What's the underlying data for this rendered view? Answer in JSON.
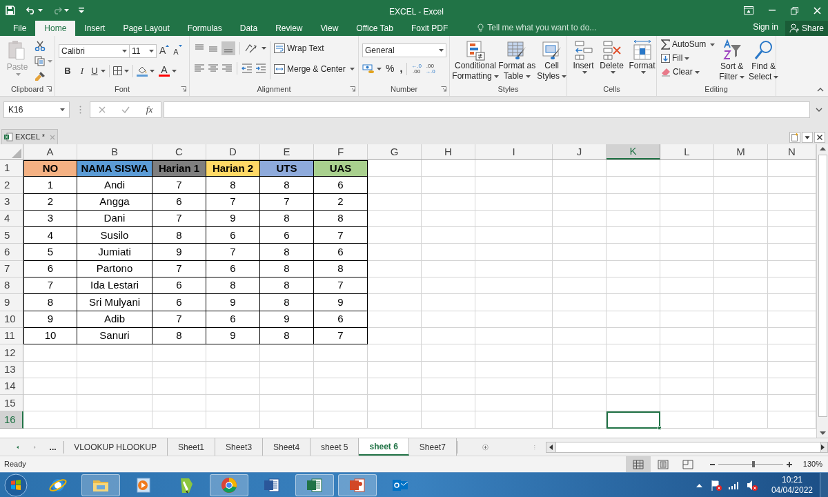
{
  "title_bar": {
    "title": "EXCEL - Excel"
  },
  "menu_tabs": [
    {
      "label": "File",
      "selected": false
    },
    {
      "label": "Home",
      "selected": true
    },
    {
      "label": "Insert",
      "selected": false
    },
    {
      "label": "Page Layout",
      "selected": false
    },
    {
      "label": "Formulas",
      "selected": false
    },
    {
      "label": "Data",
      "selected": false
    },
    {
      "label": "Review",
      "selected": false
    },
    {
      "label": "View",
      "selected": false
    },
    {
      "label": "Office Tab",
      "selected": false
    },
    {
      "label": "Foxit PDF",
      "selected": false
    }
  ],
  "tell_me": {
    "placeholder": "Tell me what you want to do..."
  },
  "sign_in": "Sign in",
  "share": "Share",
  "ribbon": {
    "clipboard": {
      "label": "Clipboard",
      "paste": "Paste"
    },
    "font": {
      "label": "Font",
      "font_name": "Calibri",
      "font_size": "11",
      "grow": "A",
      "shrink": "A",
      "bold": "B",
      "italic": "I",
      "underline": "U",
      "font_color": "A"
    },
    "alignment": {
      "label": "Alignment",
      "wrap_text": "Wrap Text",
      "merge_center": "Merge & Center"
    },
    "number": {
      "label": "Number",
      "format": "General",
      "percent": "%",
      "comma": ",",
      "increase_decimal": [
        "←.0",
        ".00"
      ],
      "decrease_decimal": [
        ".00",
        "→.0"
      ]
    },
    "styles": {
      "label": "Styles",
      "conditional": [
        "Conditional",
        "Formatting"
      ],
      "format_table": [
        "Format as",
        "Table"
      ],
      "cell_styles": [
        "Cell",
        "Styles"
      ]
    },
    "cells": {
      "label": "Cells",
      "insert": "Insert",
      "delete": "Delete",
      "format": "Format"
    },
    "editing": {
      "label": "Editing",
      "autosum": "AutoSum",
      "fill": "Fill",
      "clear": "Clear",
      "sort": [
        "Sort &",
        "Filter"
      ],
      "find": [
        "Find &",
        "Select"
      ]
    }
  },
  "name_box": {
    "value": "K16"
  },
  "formula_bar": {
    "function_label": "fx"
  },
  "document_tab": {
    "label": "EXCEL *"
  },
  "sheet": {
    "columns": [
      {
        "label": "A",
        "selected": false
      },
      {
        "label": "B",
        "selected": false
      },
      {
        "label": "C",
        "selected": false
      },
      {
        "label": "D",
        "selected": false
      },
      {
        "label": "E",
        "selected": false
      },
      {
        "label": "F",
        "selected": false
      },
      {
        "label": "G",
        "selected": false
      },
      {
        "label": "H",
        "selected": false
      },
      {
        "label": "I",
        "selected": false
      },
      {
        "label": "J",
        "selected": false
      },
      {
        "label": "K",
        "selected": true
      },
      {
        "label": "L",
        "selected": false
      },
      {
        "label": "M",
        "selected": false
      },
      {
        "label": "N",
        "selected": false
      }
    ],
    "rows": [
      {
        "label": "1",
        "selected": false,
        "cells": [
          {
            "text": "NO",
            "color": "#f4b183"
          },
          {
            "text": "NAMA SISWA",
            "color": "#5b9bd5"
          },
          {
            "text": "Harian 1",
            "color": "#7f7f7f"
          },
          {
            "text": "Harian 2",
            "color": "#ffd966"
          },
          {
            "text": "UTS",
            "color": "#8eaadb"
          },
          {
            "text": "UAS",
            "color": "#a9d08e"
          }
        ]
      },
      {
        "label": "2",
        "selected": false,
        "cells": [
          "1",
          "Andi",
          "7",
          "8",
          "8",
          "6"
        ]
      },
      {
        "label": "3",
        "selected": false,
        "cells": [
          "2",
          "Angga",
          "6",
          "7",
          "7",
          "2"
        ]
      },
      {
        "label": "4",
        "selected": false,
        "cells": [
          "3",
          "Dani",
          "7",
          "9",
          "8",
          "8"
        ]
      },
      {
        "label": "5",
        "selected": false,
        "cells": [
          "4",
          "Susilo",
          "8",
          "6",
          "6",
          "7"
        ]
      },
      {
        "label": "6",
        "selected": false,
        "cells": [
          "5",
          "Jumiati",
          "9",
          "7",
          "8",
          "6"
        ]
      },
      {
        "label": "7",
        "selected": false,
        "cells": [
          "6",
          "Partono",
          "7",
          "6",
          "8",
          "8"
        ]
      },
      {
        "label": "8",
        "selected": false,
        "cells": [
          "7",
          "Ida Lestari",
          "6",
          "8",
          "8",
          "7"
        ]
      },
      {
        "label": "9",
        "selected": false,
        "cells": [
          "8",
          "Sri Mulyani",
          "6",
          "9",
          "8",
          "9"
        ]
      },
      {
        "label": "10",
        "selected": false,
        "cells": [
          "9",
          "Adib",
          "7",
          "6",
          "9",
          "6"
        ]
      },
      {
        "label": "11",
        "selected": false,
        "cells": [
          "10",
          "Sanuri",
          "8",
          "9",
          "8",
          "7"
        ]
      },
      {
        "label": "12",
        "selected": false,
        "cells": []
      },
      {
        "label": "13",
        "selected": false,
        "cells": []
      },
      {
        "label": "14",
        "selected": false,
        "cells": []
      },
      {
        "label": "15",
        "selected": false,
        "cells": []
      },
      {
        "label": "16",
        "selected": true,
        "cells": []
      }
    ]
  },
  "more_sheets": "...",
  "sheet_tabs": [
    {
      "label": "VLOOKUP HLOOKUP",
      "selected": false
    },
    {
      "label": "Sheet1",
      "selected": false
    },
    {
      "label": "Sheet3",
      "selected": false
    },
    {
      "label": "Sheet4",
      "selected": false
    },
    {
      "label": "sheet 5",
      "selected": false
    },
    {
      "label": "sheet 6",
      "selected": true
    },
    {
      "label": "Sheet7",
      "selected": false
    }
  ],
  "status_bar": {
    "status": "Ready",
    "views": [
      {
        "selected": true
      },
      {
        "selected": false
      },
      {
        "selected": false
      }
    ],
    "zoom": {
      "level": 0.55,
      "reading": "130%"
    }
  },
  "taskbar": {
    "apps": [
      {
        "running": false
      },
      {
        "running": true
      },
      {
        "running": false
      },
      {
        "running": false
      },
      {
        "running": true
      },
      {
        "running": false
      },
      {
        "running": true
      },
      {
        "running": true
      },
      {
        "running": false
      }
    ],
    "clock": {
      "time": "10:21",
      "date": "04/04/2022"
    }
  }
}
